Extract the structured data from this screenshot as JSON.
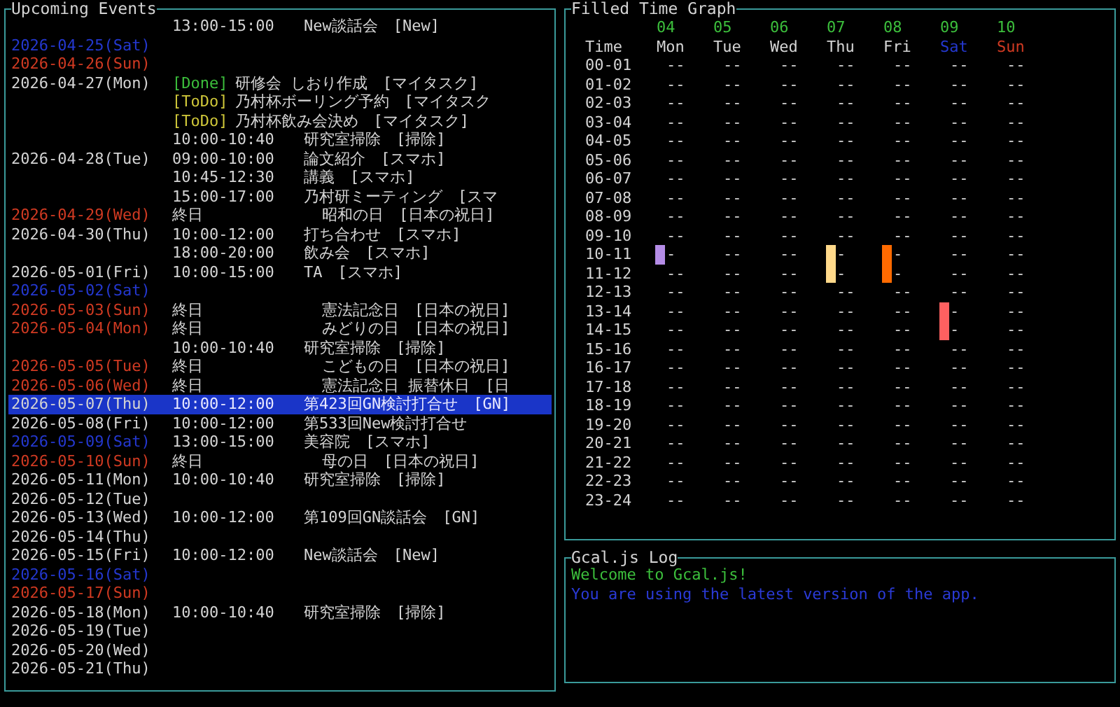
{
  "events_panel": {
    "title": "Upcoming Events",
    "rows": [
      {
        "date": "",
        "selected": false,
        "kind": "timed",
        "time": "13:00-15:00",
        "title": "New談話会　[New]"
      },
      {
        "date": "2026-04-25(Sat)",
        "color": "#2438d0",
        "selected": false,
        "kind": "none"
      },
      {
        "date": "2026-04-26(Sun)",
        "color": "#d03a22",
        "selected": false,
        "kind": "none"
      },
      {
        "date": "2026-04-27(Mon)",
        "color": "#d4d4d4",
        "selected": false,
        "kind": "task",
        "status": {
          "text": "[Done]",
          "color": "#3cbf3c"
        },
        "title": "研修会 しおり作成　[マイタスク]"
      },
      {
        "date": "",
        "selected": false,
        "kind": "task",
        "status": {
          "text": "[ToDo]",
          "color": "#d0c83a"
        },
        "title": "乃村杯ボーリング予約　[マイタスク"
      },
      {
        "date": "",
        "selected": false,
        "kind": "task",
        "status": {
          "text": "[ToDo]",
          "color": "#d0c83a"
        },
        "title": "乃村杯飲み会決め　[マイタスク]"
      },
      {
        "date": "",
        "selected": false,
        "kind": "timed",
        "time": "10:00-10:40",
        "title": "研究室掃除　[掃除]"
      },
      {
        "date": "2026-04-28(Tue)",
        "color": "#d4d4d4",
        "selected": false,
        "kind": "timed",
        "time": "09:00-10:00",
        "title": "論文紹介　[スマホ]"
      },
      {
        "date": "",
        "selected": false,
        "kind": "timed",
        "time": "10:45-12:30",
        "title": "講義　[スマホ]"
      },
      {
        "date": "",
        "selected": false,
        "kind": "timed",
        "time": "15:00-17:00",
        "title": "乃村研ミーティング　[スマ"
      },
      {
        "date": "2026-04-29(Wed)",
        "color": "#d03a22",
        "selected": false,
        "kind": "all_day",
        "time": "終日",
        "title": "昭和の日　[日本の祝日]"
      },
      {
        "date": "2026-04-30(Thu)",
        "color": "#d4d4d4",
        "selected": false,
        "kind": "timed",
        "time": "10:00-12:00",
        "title": "打ち合わせ　[スマホ]"
      },
      {
        "date": "",
        "selected": false,
        "kind": "timed",
        "time": "18:00-20:00",
        "title": "飲み会　[スマホ]"
      },
      {
        "date": "2026-05-01(Fri)",
        "color": "#d4d4d4",
        "selected": false,
        "kind": "timed",
        "time": "10:00-15:00",
        "title": "TA　[スマホ]"
      },
      {
        "date": "2026-05-02(Sat)",
        "color": "#2438d0",
        "selected": false,
        "kind": "none"
      },
      {
        "date": "2026-05-03(Sun)",
        "color": "#d03a22",
        "selected": false,
        "kind": "all_day",
        "time": "終日",
        "title": "憲法記念日　[日本の祝日]"
      },
      {
        "date": "2026-05-04(Mon)",
        "color": "#d03a22",
        "selected": false,
        "kind": "all_day",
        "time": "終日",
        "title": "みどりの日　[日本の祝日]"
      },
      {
        "date": "",
        "selected": false,
        "kind": "timed",
        "time": "10:00-10:40",
        "title": "研究室掃除　[掃除]"
      },
      {
        "date": "2026-05-05(Tue)",
        "color": "#d03a22",
        "selected": false,
        "kind": "all_day",
        "time": "終日",
        "title": "こどもの日　[日本の祝日]"
      },
      {
        "date": "2026-05-06(Wed)",
        "color": "#d03a22",
        "selected": false,
        "kind": "all_day",
        "time": "終日",
        "title": "憲法記念日 振替休日　[日"
      },
      {
        "date": "2026-05-07(Thu)",
        "color": "#d4d4d4",
        "selected": true,
        "kind": "timed",
        "time": "10:00-12:00",
        "title": "第423回GN検討打合せ　[GN]"
      },
      {
        "date": "2026-05-08(Fri)",
        "color": "#d4d4d4",
        "selected": false,
        "kind": "timed",
        "time": "10:00-12:00",
        "title": "第533回New検討打合せ"
      },
      {
        "date": "2026-05-09(Sat)",
        "color": "#2438d0",
        "selected": false,
        "kind": "timed",
        "time": "13:00-15:00",
        "title": "美容院　[スマホ]"
      },
      {
        "date": "2026-05-10(Sun)",
        "color": "#d03a22",
        "selected": false,
        "kind": "all_day",
        "time": "終日",
        "title": "母の日　[日本の祝日]"
      },
      {
        "date": "2026-05-11(Mon)",
        "color": "#d4d4d4",
        "selected": false,
        "kind": "timed",
        "time": "10:00-10:40",
        "title": "研究室掃除　[掃除]"
      },
      {
        "date": "2026-05-12(Tue)",
        "color": "#d4d4d4",
        "selected": false,
        "kind": "none"
      },
      {
        "date": "2026-05-13(Wed)",
        "color": "#d4d4d4",
        "selected": false,
        "kind": "timed",
        "time": "10:00-12:00",
        "title": "第109回GN談話会　[GN]"
      },
      {
        "date": "2026-05-14(Thu)",
        "color": "#d4d4d4",
        "selected": false,
        "kind": "none"
      },
      {
        "date": "2026-05-15(Fri)",
        "color": "#d4d4d4",
        "selected": false,
        "kind": "timed",
        "time": "10:00-12:00",
        "title": "New談話会　[New]"
      },
      {
        "date": "2026-05-16(Sat)",
        "color": "#2438d0",
        "selected": false,
        "kind": "none"
      },
      {
        "date": "2026-05-17(Sun)",
        "color": "#d03a22",
        "selected": false,
        "kind": "none"
      },
      {
        "date": "2026-05-18(Mon)",
        "color": "#d4d4d4",
        "selected": false,
        "kind": "timed",
        "time": "10:00-10:40",
        "title": "研究室掃除　[掃除]"
      },
      {
        "date": "2026-05-19(Tue)",
        "color": "#d4d4d4",
        "selected": false,
        "kind": "none"
      },
      {
        "date": "2026-05-20(Wed)",
        "color": "#d4d4d4",
        "selected": false,
        "kind": "none"
      },
      {
        "date": "2026-05-21(Thu)",
        "color": "#d4d4d4",
        "selected": false,
        "kind": "none"
      }
    ]
  },
  "time_graph": {
    "title": "Filled Time Graph",
    "time_header": "Time",
    "days": [
      {
        "date": "04",
        "day": "Mon",
        "color": "#d4d4d4"
      },
      {
        "date": "05",
        "day": "Tue",
        "color": "#d4d4d4"
      },
      {
        "date": "06",
        "day": "Wed",
        "color": "#d4d4d4"
      },
      {
        "date": "07",
        "day": "Thu",
        "color": "#d4d4d4"
      },
      {
        "date": "08",
        "day": "Fri",
        "color": "#d4d4d4"
      },
      {
        "date": "09",
        "day": "Sat",
        "color": "#2438d0"
      },
      {
        "date": "10",
        "day": "Sun",
        "color": "#d03a22"
      }
    ],
    "rows": [
      {
        "time": "00-01",
        "cells": [
          "--",
          "--",
          "--",
          "--",
          "--",
          "--",
          "--"
        ]
      },
      {
        "time": "01-02",
        "cells": [
          "--",
          "--",
          "--",
          "--",
          "--",
          "--",
          "--"
        ]
      },
      {
        "time": "02-03",
        "cells": [
          "--",
          "--",
          "--",
          "--",
          "--",
          "--",
          "--"
        ]
      },
      {
        "time": "03-04",
        "cells": [
          "--",
          "--",
          "--",
          "--",
          "--",
          "--",
          "--"
        ]
      },
      {
        "time": "04-05",
        "cells": [
          "--",
          "--",
          "--",
          "--",
          "--",
          "--",
          "--"
        ]
      },
      {
        "time": "05-06",
        "cells": [
          "--",
          "--",
          "--",
          "--",
          "--",
          "--",
          "--"
        ]
      },
      {
        "time": "06-07",
        "cells": [
          "--",
          "--",
          "--",
          "--",
          "--",
          "--",
          "--"
        ]
      },
      {
        "time": "07-08",
        "cells": [
          "--",
          "--",
          "--",
          "--",
          "--",
          "--",
          "--"
        ]
      },
      {
        "time": "08-09",
        "cells": [
          "--",
          "--",
          "--",
          "--",
          "--",
          "--",
          "--"
        ]
      },
      {
        "time": "09-10",
        "cells": [
          "--",
          "--",
          "--",
          "--",
          "--",
          "--",
          "--"
        ]
      },
      {
        "time": "10-11",
        "cells": [
          {
            "text": "-",
            "color": "#b48ce6"
          },
          "--",
          "--",
          {
            "text": "-",
            "color": "#ffd98a"
          },
          {
            "text": "-",
            "color": "#ff6a00"
          },
          "--",
          "--"
        ]
      },
      {
        "time": "11-12",
        "cells": [
          "--",
          "--",
          "--",
          {
            "text": "-",
            "color": "#ffd98a"
          },
          {
            "text": "-",
            "color": "#ff6a00"
          },
          "--",
          "--"
        ]
      },
      {
        "time": "12-13",
        "cells": [
          "--",
          "--",
          "--",
          "--",
          "--",
          "--",
          "--"
        ]
      },
      {
        "time": "13-14",
        "cells": [
          "--",
          "--",
          "--",
          "--",
          "--",
          {
            "text": "-",
            "color": "#ff6060"
          },
          "--"
        ]
      },
      {
        "time": "14-15",
        "cells": [
          "--",
          "--",
          "--",
          "--",
          "--",
          {
            "text": "-",
            "color": "#ff6060"
          },
          "--"
        ]
      },
      {
        "time": "15-16",
        "cells": [
          "--",
          "--",
          "--",
          "--",
          "--",
          "--",
          "--"
        ]
      },
      {
        "time": "16-17",
        "cells": [
          "--",
          "--",
          "--",
          "--",
          "--",
          "--",
          "--"
        ]
      },
      {
        "time": "17-18",
        "cells": [
          "--",
          "--",
          "--",
          "--",
          "--",
          "--",
          "--"
        ]
      },
      {
        "time": "18-19",
        "cells": [
          "--",
          "--",
          "--",
          "--",
          "--",
          "--",
          "--"
        ]
      },
      {
        "time": "19-20",
        "cells": [
          "--",
          "--",
          "--",
          "--",
          "--",
          "--",
          "--"
        ]
      },
      {
        "time": "20-21",
        "cells": [
          "--",
          "--",
          "--",
          "--",
          "--",
          "--",
          "--"
        ]
      },
      {
        "time": "21-22",
        "cells": [
          "--",
          "--",
          "--",
          "--",
          "--",
          "--",
          "--"
        ]
      },
      {
        "time": "22-23",
        "cells": [
          "--",
          "--",
          "--",
          "--",
          "--",
          "--",
          "--"
        ]
      },
      {
        "time": "23-24",
        "cells": [
          "--",
          "--",
          "--",
          "--",
          "--",
          "--",
          "--"
        ]
      }
    ]
  },
  "log": {
    "title": "Gcal.js Log",
    "lines": [
      {
        "text": "Welcome to Gcal.js!",
        "color": "#3cbf3c"
      },
      {
        "text": "You are using the latest version of the app.",
        "color": "#2a3ad6"
      }
    ]
  }
}
